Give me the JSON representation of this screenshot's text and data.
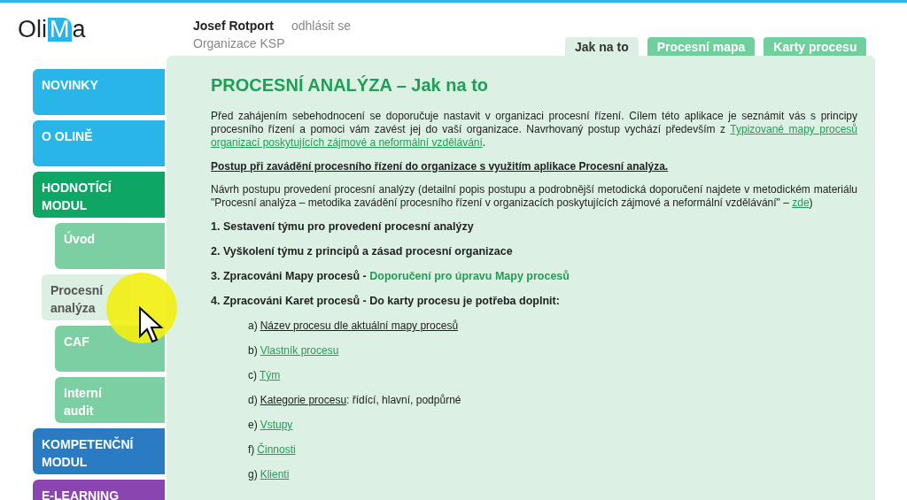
{
  "logo": {
    "before": "Oli",
    "mark": "M",
    "after": "a"
  },
  "user": {
    "name": "Josef Rotport",
    "logout": "odhlásit se",
    "organization": "Organizace KSP"
  },
  "tabs": [
    {
      "label": "Jak na to",
      "selected": true
    },
    {
      "label": "Procesní mapa",
      "selected": false
    },
    {
      "label": "Karty procesu",
      "selected": false
    }
  ],
  "sidebar": {
    "items": [
      {
        "label": "NOVINKY",
        "kind": "main",
        "color": "#29b5e8",
        "selected": false
      },
      {
        "label": "O OLINĚ",
        "kind": "main",
        "color": "#29b5e8",
        "selected": false
      },
      {
        "label": "HODNOTÍCÍ MODUL",
        "kind": "main",
        "color": "#0ea664",
        "selected": false
      },
      {
        "label": "Úvod",
        "kind": "sub",
        "color": "#7ccfa2",
        "selected": false
      },
      {
        "label": "Procesní analýza",
        "kind": "sub",
        "selected": true
      },
      {
        "label": "CAF",
        "kind": "sub",
        "color": "#7ccfa2",
        "selected": false
      },
      {
        "label": "Interní audit",
        "kind": "sub",
        "color": "#7ccfa2",
        "selected": false
      },
      {
        "label": "KOMPETENČNÍ MODUL",
        "kind": "main",
        "color": "#2a7bc1",
        "selected": false
      },
      {
        "label": "E-LEARNING",
        "kind": "main",
        "color": "#8b45b0",
        "selected": false
      }
    ]
  },
  "content": {
    "title": "PROCESNÍ ANALÝZA – Jak na to",
    "intro": [
      {
        "kind": "text",
        "text": "Před zahájením sebehodnocení se doporučuje nastavit v organizaci procesní řízení. Cílem této aplikace je seznámit vás s principy procesního řízení a pomoci vám zavést jej do vaší organizace. Navrhovaný postup vychází především z "
      },
      {
        "kind": "link",
        "text": "Typizované mapy procesů"
      },
      {
        "kind": "link",
        "text": "organizací poskytujících zájmové a neformální vzdělávání"
      },
      {
        "kind": "text",
        "text": "."
      }
    ],
    "heading": "Postup při zavádění procesního řízení do organizace s využitím aplikace Procesní analýza.",
    "description": [
      {
        "kind": "text",
        "text": "Návrh postupu provedení procesní analýzy (detailní popis postupu a podrobnější metodická doporučení najdete v metodickém materiálu \"Procesní analýza – metodika zavádění procesního řízení v organizacích poskytujících zájmové a neformální vzdělávání\" – "
      },
      {
        "kind": "link",
        "text": "zde"
      },
      {
        "kind": "text",
        "text": ")"
      }
    ],
    "steps": [
      {
        "text": "1. Sestavení týmu pro provedení procesní analýzy"
      },
      {
        "text": "2. Vyškolení týmu z principů a zásad procesní organizace"
      },
      {
        "text": "3. Zpracováni Mapy procesů - ",
        "link": "Doporučení pro úpravu Mapy procesů"
      },
      {
        "text": "4. Zpracováni Karet procesů - Do karty procesu je potřeba doplnit:"
      }
    ],
    "fields": [
      {
        "letter": "a)",
        "label": "Název procesu dle aktuální mapy procesů",
        "kind": "plain"
      },
      {
        "letter": "b)",
        "label": "Vlastník procesu",
        "kind": "link"
      },
      {
        "letter": "c)",
        "label": "Tým",
        "kind": "link"
      },
      {
        "letter": "d)",
        "label": "Kategorie procesu",
        "kind": "plain",
        "suffix": ": řídící, hlavní, podpůrné"
      },
      {
        "letter": "e)",
        "label": "Vstupy",
        "kind": "link"
      },
      {
        "letter": "f)",
        "label": "Činnosti",
        "kind": "link"
      },
      {
        "letter": "g)",
        "label": "Klienti",
        "kind": "link"
      }
    ]
  }
}
